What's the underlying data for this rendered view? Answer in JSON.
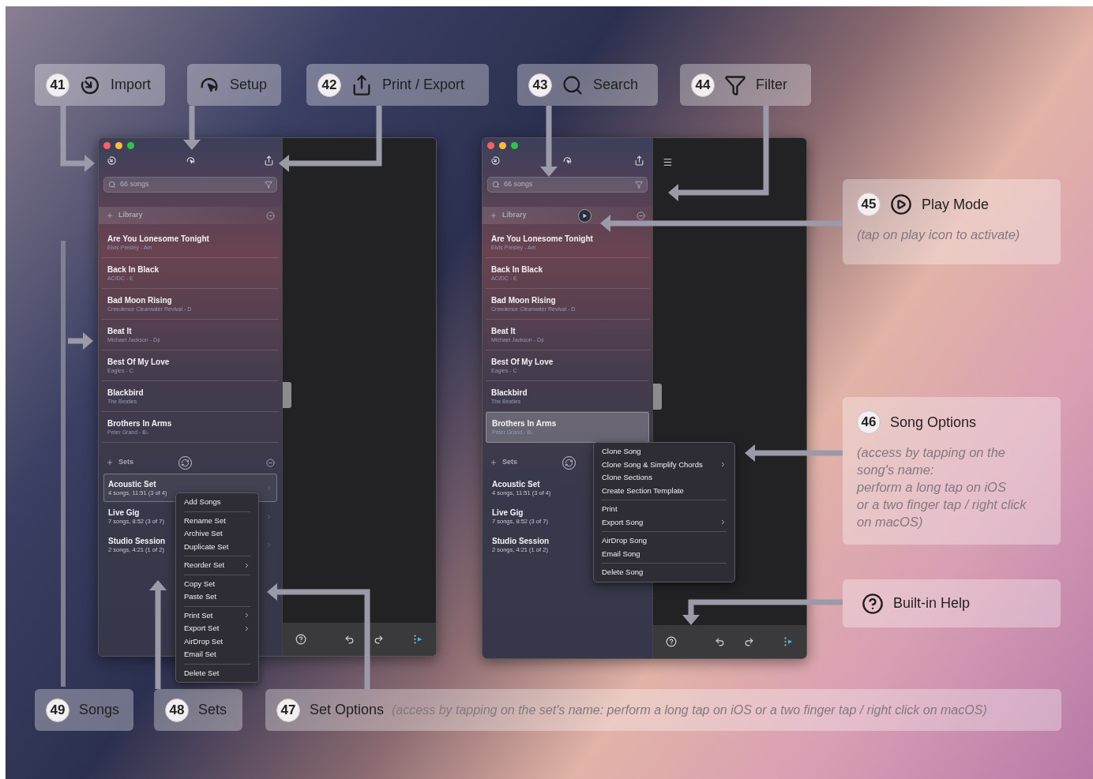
{
  "callouts": [
    {
      "number": "41",
      "kind": "import",
      "label": "Import"
    },
    {
      "kind": "setup",
      "label": "Setup"
    },
    {
      "number": "42",
      "kind": "share",
      "label": "Print / Export"
    },
    {
      "number": "43",
      "kind": "search",
      "label": "Search"
    },
    {
      "number": "44",
      "kind": "filter",
      "label": "Filter"
    },
    {
      "number": "45",
      "kind": "play",
      "label": "Play Mode",
      "note": "(tap on play icon to activate)"
    },
    {
      "number": "46",
      "label": "Song Options",
      "note": "(access by tapping on the\nsong's name:\nperform a long tap on iOS\nor a two finger tap / right click\non macOS)"
    },
    {
      "kind": "help",
      "label": "Built-in Help"
    },
    {
      "number": "49",
      "label": "Songs"
    },
    {
      "number": "48",
      "label": "Sets"
    },
    {
      "number": "47",
      "label": "Set Options",
      "note": "(access by tapping on the set's name: perform a long tap on iOS or a two finger tap / right click on macOS)"
    }
  ],
  "windows": [
    {
      "search": {
        "placeholder": "66 songs"
      },
      "library": {
        "label": "Library",
        "play_button": false
      },
      "menu_button": false,
      "songs": [
        {
          "title": "Are You Lonesome Tonight",
          "subtitle": "Elvis Presley - Am",
          "selected": false
        },
        {
          "title": "Back In Black",
          "subtitle": "AC/DC - E",
          "selected": false
        },
        {
          "title": "Bad Moon Rising",
          "subtitle": "Creedence Clearwater Revival - D",
          "selected": false
        },
        {
          "title": "Beat It",
          "subtitle": "Michael Jackson - D♯",
          "selected": false
        },
        {
          "title": "Best Of My Love",
          "subtitle": "Eagles - C",
          "selected": false
        },
        {
          "title": "Blackbird",
          "subtitle": "The Beatles",
          "selected": false
        },
        {
          "title": "Brothers In Arms",
          "subtitle": "Peter Grand - B♭",
          "selected": false
        }
      ],
      "sets_label": "Sets",
      "sets": [
        {
          "name": "Acoustic Set",
          "details": "4 songs, 11:51 (3 of 4)",
          "selected": true
        },
        {
          "name": "Live Gig",
          "details": "7 songs, 8:52 (3 of 7)",
          "selected": false
        },
        {
          "name": "Studio Session",
          "details": "2 songs, 4:21 (1 of 2)",
          "selected": false
        }
      ],
      "context_menu": {
        "groups": [
          {
            "items": [
              {
                "label": "Add Songs",
                "submenu": false
              }
            ]
          },
          {
            "items": [
              {
                "label": "Rename Set",
                "submenu": false
              },
              {
                "label": "Archive Set",
                "submenu": false
              },
              {
                "label": "Duplicate Set",
                "submenu": false
              }
            ]
          },
          {
            "items": [
              {
                "label": "Reorder Set",
                "submenu": true
              }
            ]
          },
          {
            "items": [
              {
                "label": "Copy Set",
                "submenu": false
              },
              {
                "label": "Paste Set",
                "submenu": false
              }
            ]
          },
          {
            "items": [
              {
                "label": "Print Set",
                "submenu": true
              },
              {
                "label": "Export Set",
                "submenu": true
              },
              {
                "label": "AirDrop Set",
                "submenu": false
              },
              {
                "label": "Email Set",
                "submenu": false
              }
            ]
          },
          {
            "items": [
              {
                "label": "Delete Set",
                "submenu": false
              }
            ]
          }
        ]
      }
    },
    {
      "search": {
        "placeholder": "66 songs"
      },
      "library": {
        "label": "Library",
        "play_button": true
      },
      "menu_button": true,
      "songs": [
        {
          "title": "Are You Lonesome Tonight",
          "subtitle": "Elvis Presley - Am",
          "selected": false
        },
        {
          "title": "Back In Black",
          "subtitle": "AC/DC - E",
          "selected": false
        },
        {
          "title": "Bad Moon Rising",
          "subtitle": "Creedence Clearwater Revival - D",
          "selected": false
        },
        {
          "title": "Beat It",
          "subtitle": "Michael Jackson - D♯",
          "selected": false
        },
        {
          "title": "Best Of My Love",
          "subtitle": "Eagles - C",
          "selected": false
        },
        {
          "title": "Blackbird",
          "subtitle": "The Beatles",
          "selected": false
        },
        {
          "title": "Brothers In Arms",
          "subtitle": "Peter Grand - B♭",
          "selected": true
        }
      ],
      "sets_label": "Sets",
      "sets": [
        {
          "name": "Acoustic Set",
          "details": "4 songs, 11:51 (3 of 4)",
          "selected": false
        },
        {
          "name": "Live Gig",
          "details": "7 songs, 8:52 (3 of 7)",
          "selected": false
        },
        {
          "name": "Studio Session",
          "details": "2 songs, 4:21 (1 of 2)",
          "selected": false
        }
      ],
      "context_menu": {
        "groups": [
          {
            "items": [
              {
                "label": "Clone Song",
                "submenu": false
              },
              {
                "label": "Clone Song & Simplify Chords",
                "submenu": true
              },
              {
                "label": "Clone Sections",
                "submenu": false
              },
              {
                "label": "Create Section Template",
                "submenu": false
              }
            ]
          },
          {
            "items": [
              {
                "label": "Print",
                "submenu": false
              },
              {
                "label": "Export Song",
                "submenu": true
              }
            ]
          },
          {
            "items": [
              {
                "label": "AirDrop Song",
                "submenu": false
              },
              {
                "label": "Email Song",
                "submenu": false
              }
            ]
          },
          {
            "items": [
              {
                "label": "Delete Song",
                "submenu": false
              }
            ]
          }
        ]
      }
    }
  ]
}
